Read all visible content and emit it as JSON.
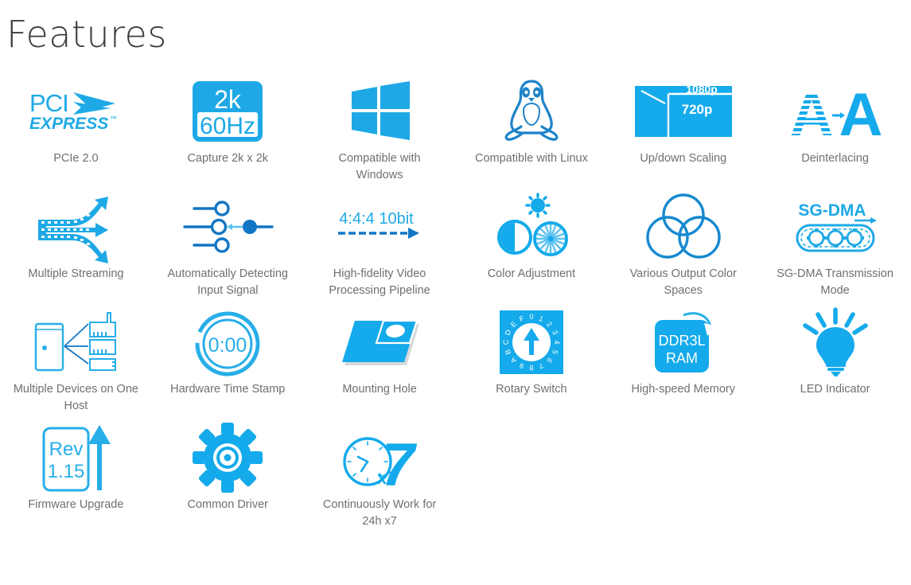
{
  "header": {
    "title": "Features"
  },
  "theme": {
    "accent": "#1EA9E6",
    "accent_dark": "#1689C6",
    "caption_color": "#6f6f6f",
    "title_color": "#3c3c3c"
  },
  "features": [
    {
      "id": "pcie",
      "icon": "pci-express-logo-icon",
      "caption": "PCIe 2.0",
      "icon_text": [
        "PCI",
        "EXPRESS"
      ]
    },
    {
      "id": "capture2k",
      "icon": "capture-resolution-badge-icon",
      "caption": "Capture 2k x 2k",
      "icon_text": [
        "2k",
        "60Hz"
      ]
    },
    {
      "id": "windows",
      "icon": "windows-logo-icon",
      "caption": "Compatible with Windows",
      "icon_text": []
    },
    {
      "id": "linux",
      "icon": "linux-penguin-icon",
      "caption": "Compatible with Linux",
      "icon_text": []
    },
    {
      "id": "scaling",
      "icon": "updown-scaling-icon",
      "caption": "Up/down Scaling",
      "icon_text": [
        "1080p",
        "720p"
      ]
    },
    {
      "id": "deinterlace",
      "icon": "deinterlacing-icon",
      "caption": "Deinterlacing",
      "icon_text": [
        "A",
        "A"
      ]
    },
    {
      "id": "multistream",
      "icon": "multiple-streaming-arrows-icon",
      "caption": "Multiple Streaming",
      "icon_text": []
    },
    {
      "id": "autodetect",
      "icon": "signal-sliders-icon",
      "caption": "Automatically Detecting Input Signal",
      "icon_text": []
    },
    {
      "id": "pipeline",
      "icon": "video-pipeline-arrow-icon",
      "caption": "High-fidelity Video Processing Pipeline",
      "icon_text": [
        "4:4:4 10bit"
      ]
    },
    {
      "id": "coloradjust",
      "icon": "color-adjustment-icon",
      "caption": "Color Adjustment",
      "icon_text": []
    },
    {
      "id": "colorspaces",
      "icon": "color-spaces-circles-icon",
      "caption": "Various Output Color Spaces",
      "icon_text": []
    },
    {
      "id": "sgdma",
      "icon": "sg-dma-conveyor-icon",
      "caption": "SG-DMA Transmission Mode",
      "icon_text": [
        "SG-DMA"
      ]
    },
    {
      "id": "multidev",
      "icon": "multiple-devices-host-icon",
      "caption": "Multiple Devices on One Host",
      "icon_text": []
    },
    {
      "id": "timestamp",
      "icon": "hardware-timer-icon",
      "caption": "Hardware Time Stamp",
      "icon_text": [
        "0:00"
      ]
    },
    {
      "id": "mounthole",
      "icon": "mounting-hole-plate-icon",
      "caption": "Mounting Hole",
      "icon_text": []
    },
    {
      "id": "rotary",
      "icon": "rotary-switch-icon",
      "caption": "Rotary Switch",
      "icon_text": [
        "0",
        "1",
        "2",
        "3",
        "4",
        "5",
        "6",
        "7",
        "8",
        "9",
        "A",
        "B",
        "C",
        "D",
        "E",
        "F"
      ]
    },
    {
      "id": "memory",
      "icon": "ddr3l-ram-icon",
      "caption": "High-speed Memory",
      "icon_text": [
        "DDR3L",
        "RAM"
      ]
    },
    {
      "id": "led",
      "icon": "led-bulb-icon",
      "caption": "LED Indicator",
      "icon_text": []
    },
    {
      "id": "firmware",
      "icon": "firmware-upgrade-icon",
      "caption": "Firmware Upgrade",
      "icon_text": [
        "Rev",
        "1.15"
      ]
    },
    {
      "id": "driver",
      "icon": "gear-driver-icon",
      "caption": "Common Driver",
      "icon_text": []
    },
    {
      "id": "continuous",
      "icon": "clock-x7-icon",
      "caption": "Continuously Work for 24h x7",
      "icon_text": [
        "x7"
      ]
    }
  ]
}
